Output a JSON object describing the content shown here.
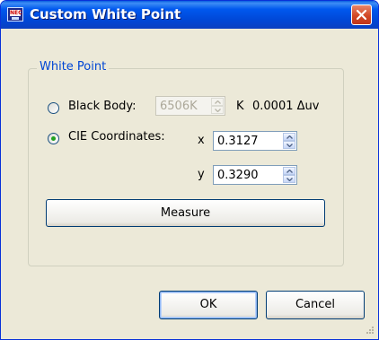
{
  "window": {
    "title": "Custom White Point",
    "icon": "monitor-icon",
    "icon_text": "NEC"
  },
  "group": {
    "title": "White Point"
  },
  "black_body": {
    "label": "Black Body:",
    "selected": false,
    "value": "6506K",
    "unit": "K",
    "delta": "0.0001 Δuv",
    "enabled": false
  },
  "cie": {
    "label": "CIE Coordinates:",
    "selected": true,
    "x_label": "x",
    "x_value": "0.3127",
    "y_label": "y",
    "y_value": "0.3290"
  },
  "buttons": {
    "measure": "Measure",
    "ok": "OK",
    "cancel": "Cancel"
  },
  "colors": {
    "title_bar": "#0058ee",
    "dialog_bg": "#ece9d8",
    "group_title": "#0046d5",
    "radio_dot": "#21a121",
    "close_button": "#d24826"
  }
}
